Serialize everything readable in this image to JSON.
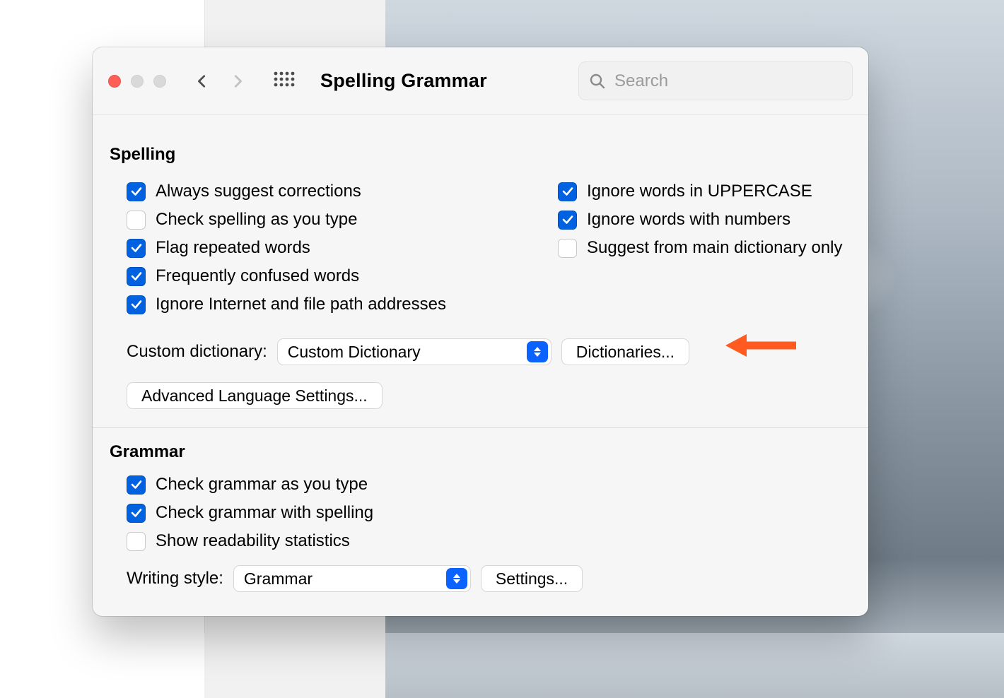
{
  "window": {
    "title": "Spelling  Grammar",
    "search_placeholder": "Search"
  },
  "spelling": {
    "header": "Spelling",
    "left": [
      {
        "label": "Always suggest corrections",
        "checked": true
      },
      {
        "label": "Check spelling as you type",
        "checked": false
      },
      {
        "label": "Flag repeated words",
        "checked": true
      },
      {
        "label": "Frequently confused words",
        "checked": true
      },
      {
        "label": "Ignore Internet and file path addresses",
        "checked": true
      }
    ],
    "right": [
      {
        "label": "Ignore words in UPPERCASE",
        "checked": true
      },
      {
        "label": "Ignore words with numbers",
        "checked": true
      },
      {
        "label": "Suggest from main dictionary only",
        "checked": false
      }
    ],
    "custom_dictionary_label": "Custom dictionary:",
    "custom_dictionary_value": "Custom Dictionary",
    "dictionaries_button": "Dictionaries...",
    "advanced_button": "Advanced Language Settings..."
  },
  "grammar": {
    "header": "Grammar",
    "options": [
      {
        "label": "Check grammar as you type",
        "checked": true
      },
      {
        "label": "Check grammar with spelling",
        "checked": true
      },
      {
        "label": "Show readability statistics",
        "checked": false
      }
    ],
    "writing_style_label": "Writing style:",
    "writing_style_value": "Grammar",
    "settings_button": "Settings..."
  },
  "annotation": {
    "arrow_color": "#ff5a1f"
  }
}
